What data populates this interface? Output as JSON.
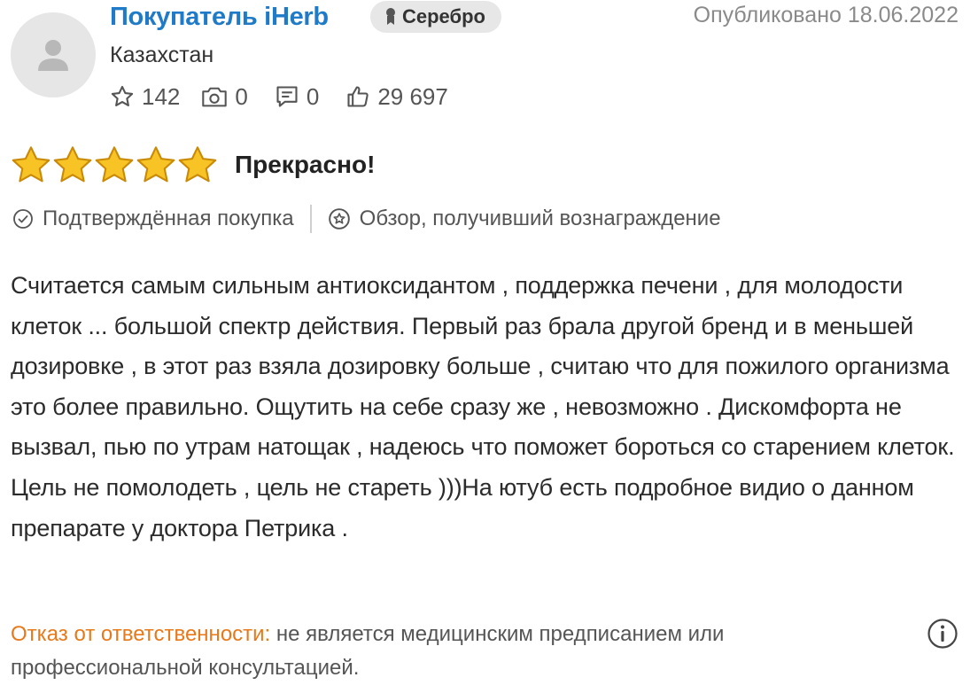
{
  "author": {
    "name": "Покупатель iHerb",
    "badge": "Серебро",
    "country": "Казахстан",
    "avatar_icon": "user-icon"
  },
  "published": "Опубликовано 18.06.2022",
  "stats": {
    "rating_count": "142",
    "photo_count": "0",
    "review_count": "0",
    "helpful_count": "29 697",
    "icons": [
      "star-outline-icon",
      "camera-icon",
      "comment-icon",
      "thumbs-up-icon"
    ]
  },
  "review": {
    "rating": 5,
    "max_rating": 5,
    "headline": "Прекрасно!",
    "verified_label": "Подтверждённая покупка",
    "rewarded_label": "Обзор, получивший вознаграждение",
    "body": "Считается самым сильным антиоксидантом , поддержка печени , для молодости клеток ... большой спектр действия. Первый раз брала другой бренд и в меньшей дозировке , в этот раз взяла дозировку больше , считаю что для пожилого организма это более правильно. Ощутить на себе сразу же , невозможно . Дискомфорта не вызвал, пью по утрам натощак , надеюсь что поможет бороться со старением клеток. Цель не помолодеть , цель не стареть )))На ютуб есть подробное видио о данном препарате у доктора Петрика ."
  },
  "disclaimer": {
    "label": "Отказ от ответственности:",
    "text": "не является медицинским предписанием или профессиональной консультацией."
  },
  "colors": {
    "author_link": "#1f7ac7",
    "star_fill": "#f7c325",
    "star_stroke": "#c98a08",
    "disclaimer_label": "#e8791a",
    "badge_bg": "#e7e7e7"
  }
}
